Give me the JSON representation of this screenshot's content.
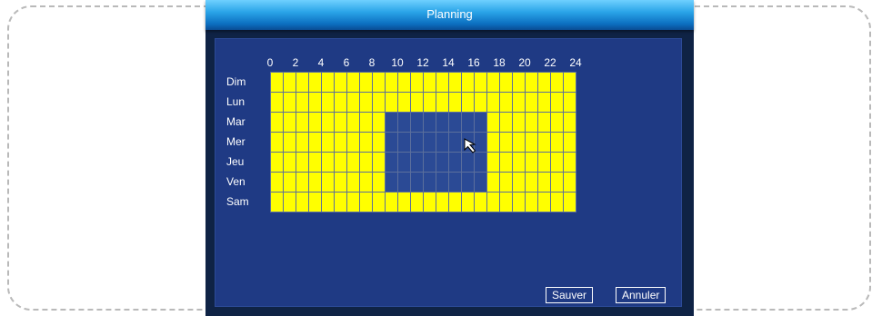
{
  "window": {
    "title": "Planning"
  },
  "schedule": {
    "hours": [
      "0",
      "2",
      "4",
      "6",
      "8",
      "10",
      "12",
      "14",
      "16",
      "18",
      "20",
      "22",
      "24"
    ],
    "days": [
      "Dim",
      "Lun",
      "Mar",
      "Mer",
      "Jeu",
      "Ven",
      "Sam"
    ],
    "slots_per_day": 24,
    "active": [
      [
        1,
        1,
        1,
        1,
        1,
        1,
        1,
        1,
        1,
        1,
        1,
        1,
        1,
        1,
        1,
        1,
        1,
        1,
        1,
        1,
        1,
        1,
        1,
        1
      ],
      [
        1,
        1,
        1,
        1,
        1,
        1,
        1,
        1,
        1,
        1,
        1,
        1,
        1,
        1,
        1,
        1,
        1,
        1,
        1,
        1,
        1,
        1,
        1,
        1
      ],
      [
        1,
        1,
        1,
        1,
        1,
        1,
        1,
        1,
        1,
        0,
        0,
        0,
        0,
        0,
        0,
        0,
        0,
        1,
        1,
        1,
        1,
        1,
        1,
        1
      ],
      [
        1,
        1,
        1,
        1,
        1,
        1,
        1,
        1,
        1,
        0,
        0,
        0,
        0,
        0,
        0,
        0,
        0,
        1,
        1,
        1,
        1,
        1,
        1,
        1
      ],
      [
        1,
        1,
        1,
        1,
        1,
        1,
        1,
        1,
        1,
        0,
        0,
        0,
        0,
        0,
        0,
        0,
        0,
        1,
        1,
        1,
        1,
        1,
        1,
        1
      ],
      [
        1,
        1,
        1,
        1,
        1,
        1,
        1,
        1,
        1,
        0,
        0,
        0,
        0,
        0,
        0,
        0,
        0,
        1,
        1,
        1,
        1,
        1,
        1,
        1
      ],
      [
        1,
        1,
        1,
        1,
        1,
        1,
        1,
        1,
        1,
        1,
        1,
        1,
        1,
        1,
        1,
        1,
        1,
        1,
        1,
        1,
        1,
        1,
        1,
        1
      ]
    ]
  },
  "buttons": {
    "save": "Sauver",
    "cancel": "Annuler"
  },
  "colors": {
    "active": "#ffff00",
    "inactive": "#2b4a95",
    "panel": "#1f3a84"
  },
  "icons": {
    "cursor": "mouse-pointer-icon"
  }
}
